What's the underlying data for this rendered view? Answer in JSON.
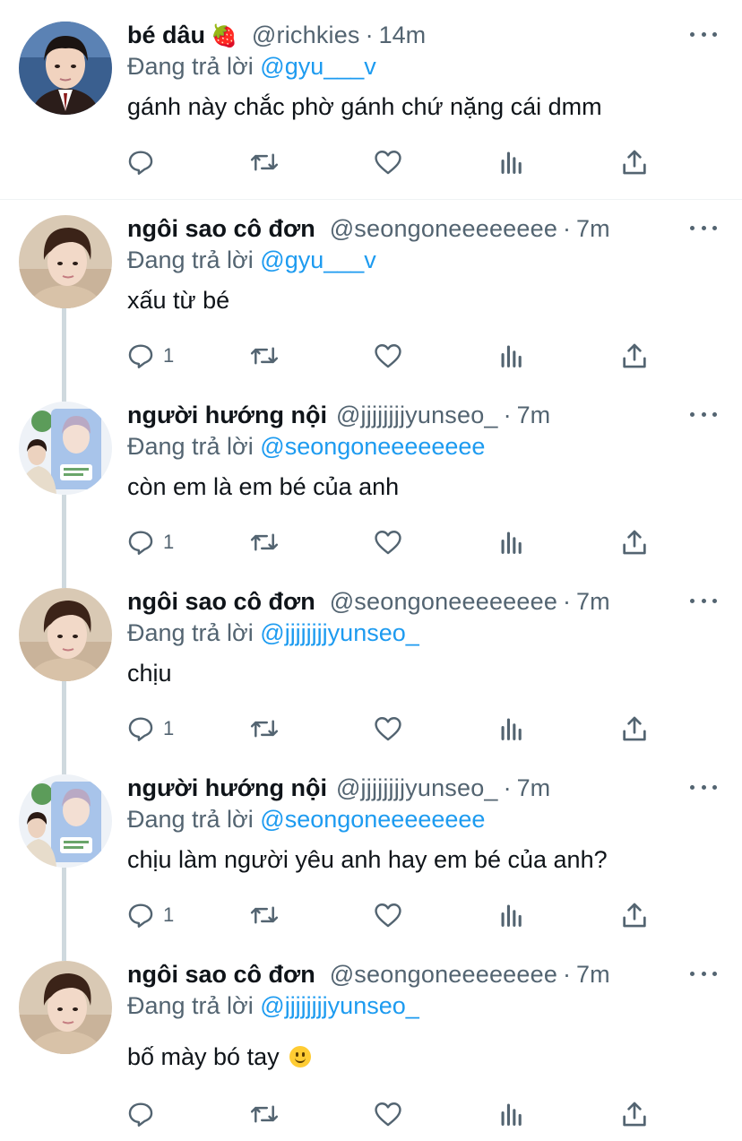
{
  "reply_prefix": "Đang trả lời",
  "colors": {
    "mention": "#1d9bf0",
    "secondary": "#536471",
    "thread_line": "#cfd9de"
  },
  "tweets": [
    {
      "name": "bé dâu",
      "name_emoji": "🍓",
      "handle": "@richkies",
      "time": "14m",
      "reply_to": "@gyu___v",
      "text": "gánh này chắc phờ gánh chứ nặng cái dmm",
      "reply_count": "",
      "avatar_icon": "avatar-boy-uniform"
    },
    {
      "name": "ngôi sao cô đơn",
      "handle": "@seongoneeeeeeee",
      "time": "7m",
      "reply_to": "@gyu___v",
      "text": "xấu từ bé",
      "reply_count": "1",
      "avatar_icon": "avatar-selfie"
    },
    {
      "name": "người hướng nội",
      "handle": "@jjjjjjjjyunseo_",
      "time": "7m",
      "reply_to": "@seongoneeeeeeee",
      "text": "còn em là em bé của anh",
      "reply_count": "1",
      "avatar_icon": "avatar-photo-card"
    },
    {
      "name": "ngôi sao cô đơn",
      "handle": "@seongoneeeeeeee",
      "time": "7m",
      "reply_to": "@jjjjjjjjyunseo_",
      "text": "chịu",
      "reply_count": "1",
      "avatar_icon": "avatar-selfie"
    },
    {
      "name": "người hướng nội",
      "handle": "@jjjjjjjjyunseo_",
      "time": "7m",
      "reply_to": "@seongoneeeeeeee",
      "text": "chịu làm người yêu anh hay em bé của anh?",
      "reply_count": "1",
      "avatar_icon": "avatar-photo-card"
    },
    {
      "name": "ngôi sao cô đơn",
      "handle": "@seongoneeeeeeee",
      "time": "7m",
      "reply_to": "@jjjjjjjjyunseo_",
      "text": "bố mày bó tay",
      "text_emoji": "🙂",
      "reply_count": "",
      "avatar_icon": "avatar-selfie"
    }
  ]
}
